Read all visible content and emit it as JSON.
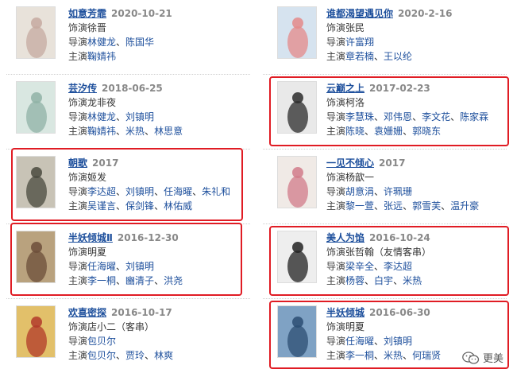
{
  "colors": {
    "link": "#1d4f9c",
    "highlight_border": "#e01c24",
    "date": "#888888"
  },
  "left": [
    {
      "title": "如意芳霏",
      "date": "2020-10-21",
      "role_label": "饰演",
      "role": "徐晋",
      "director_label": "导演",
      "directors": [
        "林健龙",
        "陈国华"
      ],
      "cast_label": "主演",
      "cast": [
        "鞠婧祎"
      ],
      "highlighted": false,
      "poster": {
        "bg": "#e8e2da",
        "accent": "#c6a9a0"
      }
    },
    {
      "title": "芸汐传",
      "date": "2018-06-25",
      "role_label": "饰演",
      "role": "龙非夜",
      "director_label": "导演",
      "directors": [
        "林健龙",
        "刘镇明"
      ],
      "cast_label": "主演",
      "cast": [
        "鞠婧祎",
        "米热",
        "林思意"
      ],
      "highlighted": false,
      "poster": {
        "bg": "#d9e7e1",
        "accent": "#8fb2a6"
      }
    },
    {
      "title": "朝歌",
      "date": "2017",
      "role_label": "饰演",
      "role": "姬发",
      "director_label": "导演",
      "directors": [
        "李达超",
        "刘镇明",
        "任海曜",
        "朱礼和"
      ],
      "cast_label": "主演",
      "cast": [
        "吴谨言",
        "保剑锋",
        "林佑威"
      ],
      "highlighted": true,
      "poster": {
        "bg": "#c8c3b6",
        "accent": "#4a4a3e"
      }
    },
    {
      "title": "半妖倾城Ⅱ",
      "date": "2016-12-30",
      "role_label": "饰演",
      "role": "明夏",
      "director_label": "导演",
      "directors": [
        "任海曜",
        "刘镇明"
      ],
      "cast_label": "主演",
      "cast": [
        "李一桐",
        "豳清子",
        "洪尧"
      ],
      "highlighted": true,
      "poster": {
        "bg": "#b9a27e",
        "accent": "#6c4e3a"
      }
    },
    {
      "title": "欢喜密探",
      "date": "2016-10-17",
      "role_label": "饰演",
      "role": "店小二（客串）",
      "director_label": "导演",
      "directors": [
        "包贝尔"
      ],
      "cast_label": "主演",
      "cast": [
        "包贝尔",
        "贾玲",
        "林爽"
      ],
      "highlighted": false,
      "poster": {
        "bg": "#e2c06a",
        "accent": "#b23a2a"
      }
    }
  ],
  "right": [
    {
      "title": "谁都渴望遇见你",
      "date": "2020-2-16",
      "role_label": "饰演",
      "role": "张民",
      "director_label": "导演",
      "directors": [
        "许富翔"
      ],
      "cast_label": "主演",
      "cast": [
        "章若楠",
        "王以纶"
      ],
      "highlighted": false,
      "poster": {
        "bg": "#d6e3ef",
        "accent": "#e48a8a"
      }
    },
    {
      "title": "云巅之上",
      "date": "2017-02-23",
      "role_label": "饰演",
      "role": "柯洛",
      "director_label": "导演",
      "directors": [
        "李慧珠",
        "邓伟恩",
        "李文花",
        "陈家霖"
      ],
      "cast_label": "主演",
      "cast": [
        "陈晓",
        "袁姗姗",
        "郭晓东"
      ],
      "highlighted": true,
      "poster": {
        "bg": "#e9e9e9",
        "accent": "#2b2b2b"
      }
    },
    {
      "title": "一见不倾心",
      "date": "2017",
      "role_label": "饰演",
      "role": "杨歆一",
      "director_label": "导演",
      "directors": [
        "胡意涓",
        "许珮珊"
      ],
      "cast_label": "主演",
      "cast": [
        "黎一萱",
        "张远",
        "郭雪芙",
        "温升豪"
      ],
      "highlighted": false,
      "poster": {
        "bg": "#f0eae6",
        "accent": "#d17b8a"
      }
    },
    {
      "title": "美人为馅",
      "date": "2016-10-24",
      "role_label": "饰演",
      "role": "张哲翰（友情客串）",
      "director_label": "导演",
      "directors": [
        "梁辛全",
        "李达超"
      ],
      "cast_label": "主演",
      "cast": [
        "杨蓉",
        "白宇",
        "米热"
      ],
      "highlighted": true,
      "poster": {
        "bg": "#eeeeee",
        "accent": "#222222"
      }
    },
    {
      "title": "半妖倾城",
      "date": "2016-06-30",
      "role_label": "饰演",
      "role": "明夏",
      "director_label": "导演",
      "directors": [
        "任海曜",
        "刘镇明"
      ],
      "cast_label": "主演",
      "cast": [
        "李一桐",
        "米热",
        "何瑞贤"
      ],
      "highlighted": true,
      "poster": {
        "bg": "#7fa2c4",
        "accent": "#2c4d73"
      }
    }
  ],
  "watermark": {
    "text": "更美",
    "icon": "wechat-icon"
  }
}
